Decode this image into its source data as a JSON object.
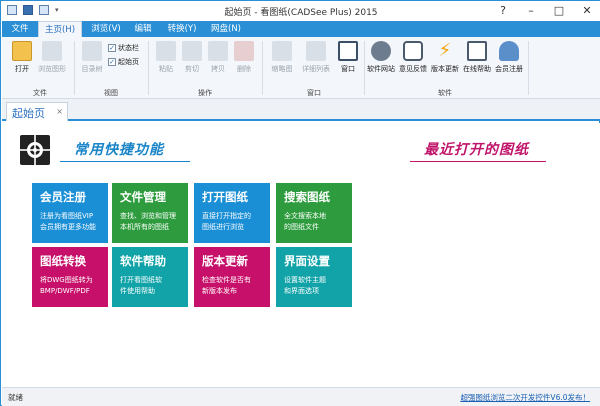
{
  "window": {
    "title": "起始页 - 看图纸(CADSee Plus) 2015"
  },
  "tabs": [
    "文件",
    "主页(H)",
    "浏览(V)",
    "编辑",
    "转换(Y)",
    "网盘(N)"
  ],
  "ribbon": {
    "file_group": {
      "label": "文件",
      "buttons": [
        "打开",
        "浏览图形"
      ]
    },
    "view_group": {
      "label": "视图",
      "buttons": [
        "目录树"
      ],
      "checks": [
        "状态栏",
        "起始页"
      ]
    },
    "operate_group": {
      "label": "操作",
      "buttons": [
        "粘贴",
        "剪切",
        "拷贝",
        "删除"
      ]
    },
    "window_group": {
      "label": "窗口",
      "buttons": [
        "缩略图",
        "详细列表",
        "窗口"
      ]
    },
    "software_group": {
      "label": "软件",
      "buttons": [
        "软件网站",
        "意见反馈",
        "版本更新",
        "在线帮助",
        "会员注册"
      ]
    }
  },
  "doc_tab": {
    "label": "起始页",
    "close": "×"
  },
  "sections": {
    "left_title": "常用快捷功能",
    "right_title": "最近打开的图纸"
  },
  "tiles": [
    {
      "title": "会员注册",
      "desc": [
        "注册为看图纸VIP",
        "会员拥有更多功能"
      ],
      "color": "#1a8fd6"
    },
    {
      "title": "文件管理",
      "desc": [
        "查找、浏览和管理",
        "本机所有的图纸"
      ],
      "color": "#2e9c3e"
    },
    {
      "title": "打开图纸",
      "desc": [
        "直接打开指定的",
        "图纸进行浏览"
      ],
      "color": "#1a8fd6"
    },
    {
      "title": "搜索图纸",
      "desc": [
        "全文搜索本地",
        "的图纸文件"
      ],
      "color": "#2e9c3e"
    },
    {
      "title": "图纸转换",
      "desc": [
        "将DWG图纸转为",
        "BMP/DWF/PDF"
      ],
      "color": "#c7106a"
    },
    {
      "title": "软件帮助",
      "desc": [
        "打开看图纸软",
        "件使用帮助"
      ],
      "color": "#11a3a8"
    },
    {
      "title": "版本更新",
      "desc": [
        "检查软件是否有",
        "新版本发布"
      ],
      "color": "#c7106a"
    },
    {
      "title": "界面设置",
      "desc": [
        "设置软件主题",
        "和界面选项"
      ],
      "color": "#11a3a8"
    }
  ],
  "status": {
    "left": "就绪",
    "right": "超强图纸浏览二次开发控件V6.0发布！"
  },
  "colors": {
    "accent": "#2b8fd6",
    "left_title": "#1a84c8",
    "right_title": "#c0156a"
  },
  "icons": {
    "open": "folder-open-icon",
    "browse": "browse-icon",
    "tree": "tree-icon",
    "paste": "paste-icon",
    "cut": "scissors-icon",
    "copy": "copy-icon",
    "delete": "delete-icon",
    "thumb": "thumbnail-icon",
    "details": "details-list-icon",
    "window": "window-icon",
    "website": "globe-icon",
    "feedback": "chat-icon",
    "update": "lightning-icon",
    "help": "help-book-icon",
    "member": "member-icon"
  }
}
